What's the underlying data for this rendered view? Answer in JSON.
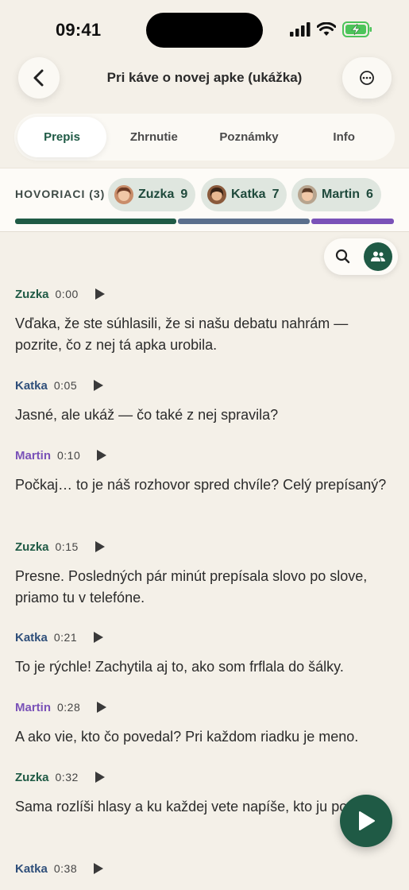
{
  "status": {
    "time": "09:41"
  },
  "header": {
    "title": "Pri káve o novej apke (ukážka)"
  },
  "tabs": [
    {
      "label": "Prepis",
      "active": true
    },
    {
      "label": "Zhrnutie",
      "active": false
    },
    {
      "label": "Poznámky",
      "active": false
    },
    {
      "label": "Info",
      "active": false
    }
  ],
  "speakers": {
    "label": "HOVORIACI (3)",
    "items": [
      {
        "name": "Zuzka",
        "count": "9",
        "color": "#1f5a45"
      },
      {
        "name": "Katka",
        "count": "7",
        "color": "#5b6f8c"
      },
      {
        "name": "Martin",
        "count": "6",
        "color": "#7a52b8"
      }
    ],
    "share": [
      0.43,
      0.35,
      0.22
    ]
  },
  "transcript": [
    {
      "speaker": "Zuzka",
      "time": "0:00",
      "text": "Vďaka, že ste súhlasili, že si našu debatu nahrám — pozrite, čo z nej tá apka urobila."
    },
    {
      "speaker": "Katka",
      "time": "0:05",
      "text": "Jasné, ale ukáž — čo také z nej spravila?"
    },
    {
      "speaker": "Martin",
      "time": "0:10",
      "text": "Počkaj… to je náš rozhovor spred chvíle? Celý prepísaný?"
    },
    {
      "speaker": "Zuzka",
      "time": "0:15",
      "text": "Presne. Posledných pár minút prepísala slovo po slove, priamo tu v telefóne."
    },
    {
      "speaker": "Katka",
      "time": "0:21",
      "text": "To je rýchle! Zachytila aj to, ako som frflala do šálky."
    },
    {
      "speaker": "Martin",
      "time": "0:28",
      "text": "A ako vie, kto čo povedal? Pri každom riadku je meno."
    },
    {
      "speaker": "Zuzka",
      "time": "0:32",
      "text": "Sama rozlíši hlasy a ku každej vete napíše, kto ju povedal."
    },
    {
      "speaker": "Katka",
      "time": "0:38",
      "text": ""
    }
  ],
  "colors": {
    "Zuzka": "#1f5a45",
    "Katka": "#2f4f7a",
    "Martin": "#7a52b8",
    "accent": "#1f5a45"
  },
  "icons": [
    "back-chevron-icon",
    "more-icon",
    "search-icon",
    "people-icon",
    "play-icon"
  ]
}
